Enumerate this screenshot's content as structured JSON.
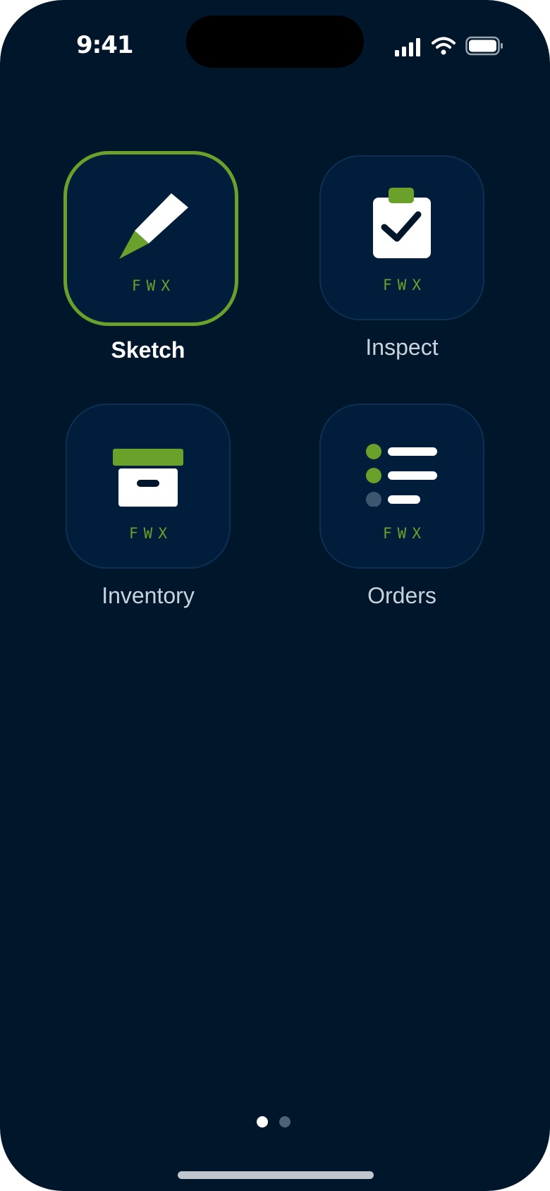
{
  "status_bar": {
    "time": "9:41"
  },
  "apps": [
    {
      "id": "sketch",
      "label": "Sketch",
      "tag": "FWX",
      "icon": "pencil-icon",
      "active": true
    },
    {
      "id": "inspect",
      "label": "Inspect",
      "tag": "FWX",
      "icon": "clipboard-check-icon",
      "active": false
    },
    {
      "id": "inventory",
      "label": "Inventory",
      "tag": "FWX",
      "icon": "archive-box-icon",
      "active": false
    },
    {
      "id": "orders",
      "label": "Orders",
      "tag": "FWX",
      "icon": "list-icon",
      "active": false
    }
  ],
  "page_indicator": {
    "current": 1,
    "total": 2
  },
  "colors": {
    "background": "#00172b",
    "tile": "#001e3c",
    "accent": "#6aa12a",
    "text": "#c9d3de"
  }
}
